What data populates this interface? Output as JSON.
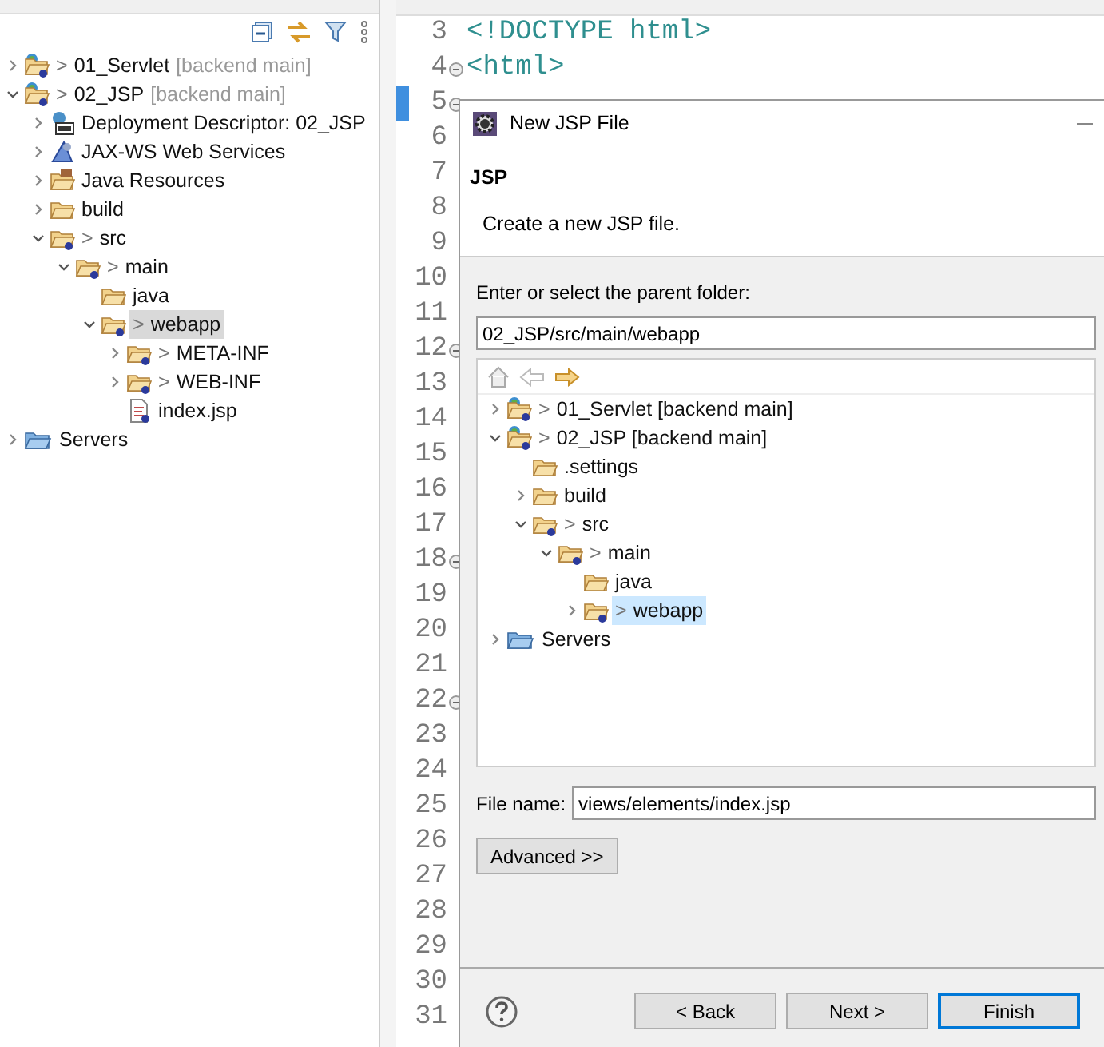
{
  "project_explorer": {
    "tree": [
      {
        "kind": "project",
        "prefix": ">",
        "label": "01_Servlet",
        "tag": "[backend main]",
        "expanded": false,
        "selected": false
      },
      {
        "kind": "project",
        "prefix": ">",
        "label": "02_JSP",
        "tag": "[backend main]",
        "expanded": true,
        "selected": false,
        "children": [
          {
            "kind": "descriptor",
            "label": "Deployment Descriptor: 02_JSP",
            "expanded": false,
            "selected": false
          },
          {
            "kind": "webservices",
            "label": "JAX-WS Web Services",
            "expanded": false,
            "selected": false
          },
          {
            "kind": "resources",
            "label": "Java Resources",
            "expanded": false,
            "selected": false
          },
          {
            "kind": "folder",
            "label": "build",
            "expanded": false,
            "selected": false
          },
          {
            "kind": "gitfolder",
            "prefix": ">",
            "label": "src",
            "expanded": true,
            "selected": false,
            "children": [
              {
                "kind": "gitfolder",
                "prefix": ">",
                "label": "main",
                "expanded": true,
                "selected": false,
                "children": [
                  {
                    "kind": "folder",
                    "label": "java",
                    "selected": false
                  },
                  {
                    "kind": "gitfolder",
                    "prefix": ">",
                    "label": "webapp",
                    "expanded": true,
                    "selected": true,
                    "children": [
                      {
                        "kind": "gitfolder",
                        "prefix": ">",
                        "label": "META-INF",
                        "expanded": false,
                        "selected": false
                      },
                      {
                        "kind": "gitfolder",
                        "prefix": ">",
                        "label": "WEB-INF",
                        "expanded": false,
                        "selected": false
                      },
                      {
                        "kind": "file",
                        "label": "index.jsp",
                        "selected": false
                      }
                    ]
                  }
                ]
              }
            ]
          }
        ]
      },
      {
        "kind": "servers",
        "label": "Servers",
        "expanded": false,
        "selected": false
      }
    ]
  },
  "editor": {
    "lines": [
      {
        "number": "3",
        "code": "<!DOCTYPE html>",
        "fold": false,
        "marker": false
      },
      {
        "number": "4",
        "code": "<html>",
        "fold": true,
        "marker": false
      },
      {
        "number": "5",
        "fold": true,
        "marker": true
      },
      {
        "number": "6",
        "fold": false,
        "marker": false
      },
      {
        "number": "7",
        "fold": false,
        "marker": false
      },
      {
        "number": "8",
        "fold": false,
        "marker": false
      },
      {
        "number": "9",
        "fold": false,
        "marker": false
      },
      {
        "number": "10",
        "fold": false,
        "marker": false
      },
      {
        "number": "11",
        "fold": false,
        "marker": false
      },
      {
        "number": "12",
        "fold": true,
        "marker": false
      },
      {
        "number": "13",
        "fold": false,
        "marker": false
      },
      {
        "number": "14",
        "fold": false,
        "marker": false
      },
      {
        "number": "15",
        "fold": false,
        "marker": false
      },
      {
        "number": "16",
        "fold": false,
        "marker": false
      },
      {
        "number": "17",
        "fold": false,
        "marker": false
      },
      {
        "number": "18",
        "fold": true,
        "marker": false
      },
      {
        "number": "19",
        "fold": false,
        "marker": false
      },
      {
        "number": "20",
        "fold": false,
        "marker": false
      },
      {
        "number": "21",
        "fold": false,
        "marker": false
      },
      {
        "number": "22",
        "fold": true,
        "marker": false
      },
      {
        "number": "23",
        "fold": false,
        "marker": false
      },
      {
        "number": "24",
        "fold": false,
        "marker": false
      },
      {
        "number": "25",
        "fold": false,
        "marker": false
      },
      {
        "number": "26",
        "fold": false,
        "marker": false
      },
      {
        "number": "27",
        "fold": false,
        "marker": false
      },
      {
        "number": "28",
        "fold": false,
        "marker": false
      },
      {
        "number": "29",
        "fold": false,
        "marker": false
      },
      {
        "number": "30",
        "fold": false,
        "marker": false
      },
      {
        "number": "31",
        "fold": false,
        "marker": false
      }
    ]
  },
  "dialog": {
    "title": "New JSP File",
    "heading": "JSP",
    "description": "Create a new JSP file.",
    "folder_label": "Enter or select the parent folder:",
    "folder_value": "02_JSP/src/main/webapp",
    "tree": [
      {
        "kind": "project",
        "prefix": ">",
        "label": "01_Servlet [backend main]",
        "expanded": false,
        "selected": false
      },
      {
        "kind": "project",
        "prefix": ">",
        "label": "02_JSP [backend main]",
        "expanded": true,
        "selected": false,
        "children": [
          {
            "kind": "folder",
            "label": ".settings",
            "selected": false
          },
          {
            "kind": "folder",
            "label": "build",
            "expanded": false,
            "selected": false
          },
          {
            "kind": "gitfolder",
            "prefix": ">",
            "label": "src",
            "expanded": true,
            "selected": false,
            "children": [
              {
                "kind": "gitfolder",
                "prefix": ">",
                "label": "main",
                "expanded": true,
                "selected": false,
                "children": [
                  {
                    "kind": "folder",
                    "label": "java",
                    "selected": false
                  },
                  {
                    "kind": "gitfolder",
                    "prefix": ">",
                    "label": "webapp",
                    "expanded": false,
                    "selected": true
                  }
                ]
              }
            ]
          }
        ]
      },
      {
        "kind": "servers",
        "label": "Servers",
        "expanded": false,
        "selected": false
      }
    ],
    "file_name_label": "File name:",
    "file_name_value": "views/elements/index.jsp",
    "advanced_button": "Advanced >>",
    "buttons": [
      {
        "label": "< Back",
        "default": false
      },
      {
        "label": "Next >",
        "default": false
      },
      {
        "label": "Finish",
        "default": true
      }
    ]
  }
}
